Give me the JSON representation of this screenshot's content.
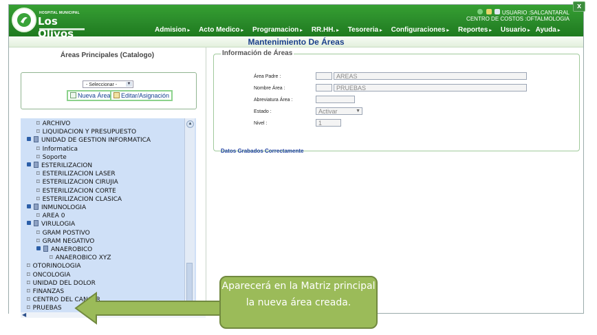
{
  "header": {
    "logo_small_text": "HOSPITAL MUNICIPAL",
    "logo_name": "Los Olivos",
    "menu": [
      "Admision",
      "Acto Medico",
      "Programacion",
      "RR.HH.",
      "Tesoreria",
      "Configuraciones",
      "Reportes",
      "Usuario",
      "Ayuda"
    ],
    "user_line": "USUARIO :SALCANTARAL",
    "cost_center_line": "CENTRO DE COSTOS :OFTALMOLOGIA",
    "close_label": "x",
    "colors": {
      "header_green": "#2a8a2a",
      "title_blue": "#1a3f8a"
    }
  },
  "page": {
    "title": "Mantenimiento De Áreas"
  },
  "left_panel": {
    "title": "Áreas Principales (Catalogo)",
    "select_value": "- Seleccionar -",
    "new_area_button": "Nueva Área",
    "edit_button": "Editar/Asignación",
    "tree": [
      {
        "label": "ARCHIVO",
        "type": "leaf",
        "level": 2
      },
      {
        "label": "LIQUIDACION Y PRESUPUESTO",
        "type": "leaf",
        "level": 2
      },
      {
        "label": "UNIDAD DE GESTION INFORMATICA",
        "type": "folder",
        "level": 1
      },
      {
        "label": "Informatica",
        "type": "leaf",
        "level": 2
      },
      {
        "label": "Soporte",
        "type": "leaf",
        "level": 2
      },
      {
        "label": "ESTERILIZACION",
        "type": "folder",
        "level": 1
      },
      {
        "label": "ESTERILIZACION LASER",
        "type": "leaf",
        "level": 2
      },
      {
        "label": "ESTERILIZACION CIRUJIA",
        "type": "leaf",
        "level": 2
      },
      {
        "label": "ESTERILIZACION CORTE",
        "type": "leaf",
        "level": 2
      },
      {
        "label": "ESTERILIZACION CLASICA",
        "type": "leaf",
        "level": 2
      },
      {
        "label": "INMUNOLOGIA",
        "type": "folder",
        "level": 1
      },
      {
        "label": "AREA 0",
        "type": "leaf",
        "level": 2
      },
      {
        "label": "VIRULOGIA",
        "type": "folder",
        "level": 1
      },
      {
        "label": "GRAM POSTIVO",
        "type": "leaf",
        "level": 2
      },
      {
        "label": "GRAM NEGATIVO",
        "type": "leaf",
        "level": 2
      },
      {
        "label": "ANAEROBICO",
        "type": "folder",
        "level": 2
      },
      {
        "label": "ANAEROBICO XYZ",
        "type": "leaf",
        "level": 3
      },
      {
        "label": "OTORINOLOGIA",
        "type": "leaf",
        "level": 1
      },
      {
        "label": "ONCOLOGIA",
        "type": "leaf",
        "level": 1
      },
      {
        "label": "UNIDAD DEL DOLOR",
        "type": "leaf",
        "level": 1
      },
      {
        "label": "FINANZAS",
        "type": "leaf",
        "level": 1
      },
      {
        "label": "CENTRO DEL CANCER",
        "type": "leaf",
        "level": 1
      },
      {
        "label": "PRUEBAS",
        "type": "leaf",
        "level": 1
      }
    ]
  },
  "form": {
    "legend": "Información de Áreas",
    "parent_label": "Área Padre :",
    "parent_code": "",
    "parent_value": "AREAS",
    "name_label": "Nombre Área :",
    "name_code": "",
    "name_value": "PRUEBAS",
    "abbr_label": "Abreviatura Área :",
    "abbr_value": "",
    "state_label": "Estado :",
    "state_value": "Activar",
    "level_label": "Nivel :",
    "level_value": "1",
    "success_message": "Datos Grabados Correctamente"
  },
  "callout": {
    "text": "Aparecerá en la Matriz principal la nueva área creada.",
    "fill": "#9bbb59"
  }
}
